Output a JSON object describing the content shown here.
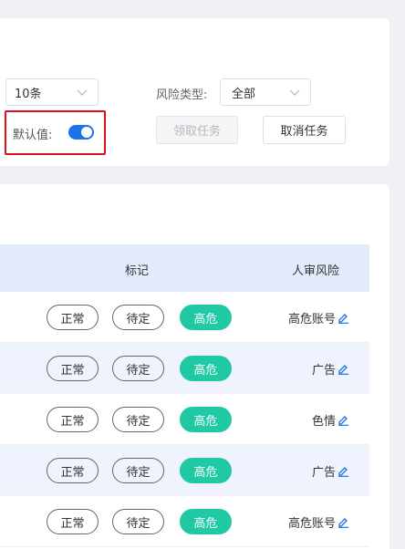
{
  "filters": {
    "page_size": "10条",
    "risk_type_label": "风险类型:",
    "risk_type_value": "全部",
    "default_label": "默认值:",
    "default_on": true
  },
  "actions": {
    "claim_task": "领取任务",
    "cancel_task": "取消任务"
  },
  "table": {
    "columns": [
      "标记",
      "人审风险"
    ],
    "rows": [
      {
        "tags": [
          "正常",
          "待定",
          "高危"
        ],
        "risk": "高危账号"
      },
      {
        "tags": [
          "正常",
          "待定",
          "高危"
        ],
        "risk": "广告"
      },
      {
        "tags": [
          "正常",
          "待定",
          "高危"
        ],
        "risk": "色情"
      },
      {
        "tags": [
          "正常",
          "待定",
          "高危"
        ],
        "risk": "广告"
      },
      {
        "tags": [
          "正常",
          "待定",
          "高危"
        ],
        "risk": "高危账号"
      }
    ]
  },
  "colors": {
    "accent": "#1a73e8",
    "danger_tag": "#1fc9a4",
    "header_bg": "#e3eafb",
    "highlight_border": "#e0101a"
  }
}
